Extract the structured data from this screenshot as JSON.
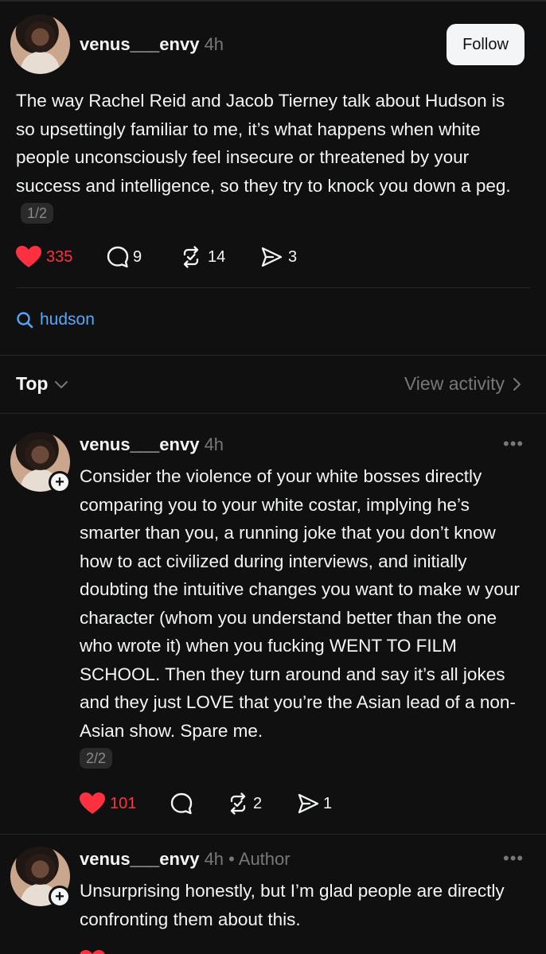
{
  "post": {
    "username": "venus___envy",
    "time": "4h",
    "follow_label": "Follow",
    "text": "The way Rachel Reid and Jacob Tierney talk about Hudson is so upsettingly familiar to me, it’s what happens when white people unconsciously feel insecure or threatened by your success and intelligence, so they try to knock you down a peg.",
    "page": "1/2",
    "likes": "335",
    "replies": "9",
    "reposts": "14",
    "shares": "3"
  },
  "topic": {
    "label": "hudson"
  },
  "sort": {
    "label": "Top",
    "view_activity": "View activity"
  },
  "replies": [
    {
      "username": "venus___envy",
      "time": "4h",
      "text": "Consider the violence of your white bosses directly comparing you to your white costar, implying he’s smarter than you, a running joke that you don’t know how to act civilized during interviews, and initially doubting the intuitive changes you want to make w your character (whom you understand better than the one who wrote it) when you fucking WENT TO FILM SCHOOL. Then they turn around and say it’s all jokes and they just LOVE that you’re the Asian lead of a non-Asian show. Spare me.",
      "page": "2/2",
      "likes": "101",
      "reposts": "2",
      "shares": "1"
    },
    {
      "username": "venus___envy",
      "time": "4h",
      "author_tag": "• Author",
      "text": "Unsurprising honestly, but I’m glad people are directly confronting them about this."
    }
  ],
  "icons": {
    "heart": "heart-icon",
    "reply": "speech-bubble-icon",
    "repost": "repost-icon",
    "share": "send-icon",
    "search": "search-icon",
    "chevron_down": "chevron-down-icon",
    "chevron_right": "chevron-right-icon",
    "more": "more-icon",
    "plus": "plus-icon"
  },
  "colors": {
    "background": "#101010",
    "text": "#f3f5f7",
    "muted": "#777777",
    "like": "#ff3040",
    "link": "#55a8ff"
  }
}
